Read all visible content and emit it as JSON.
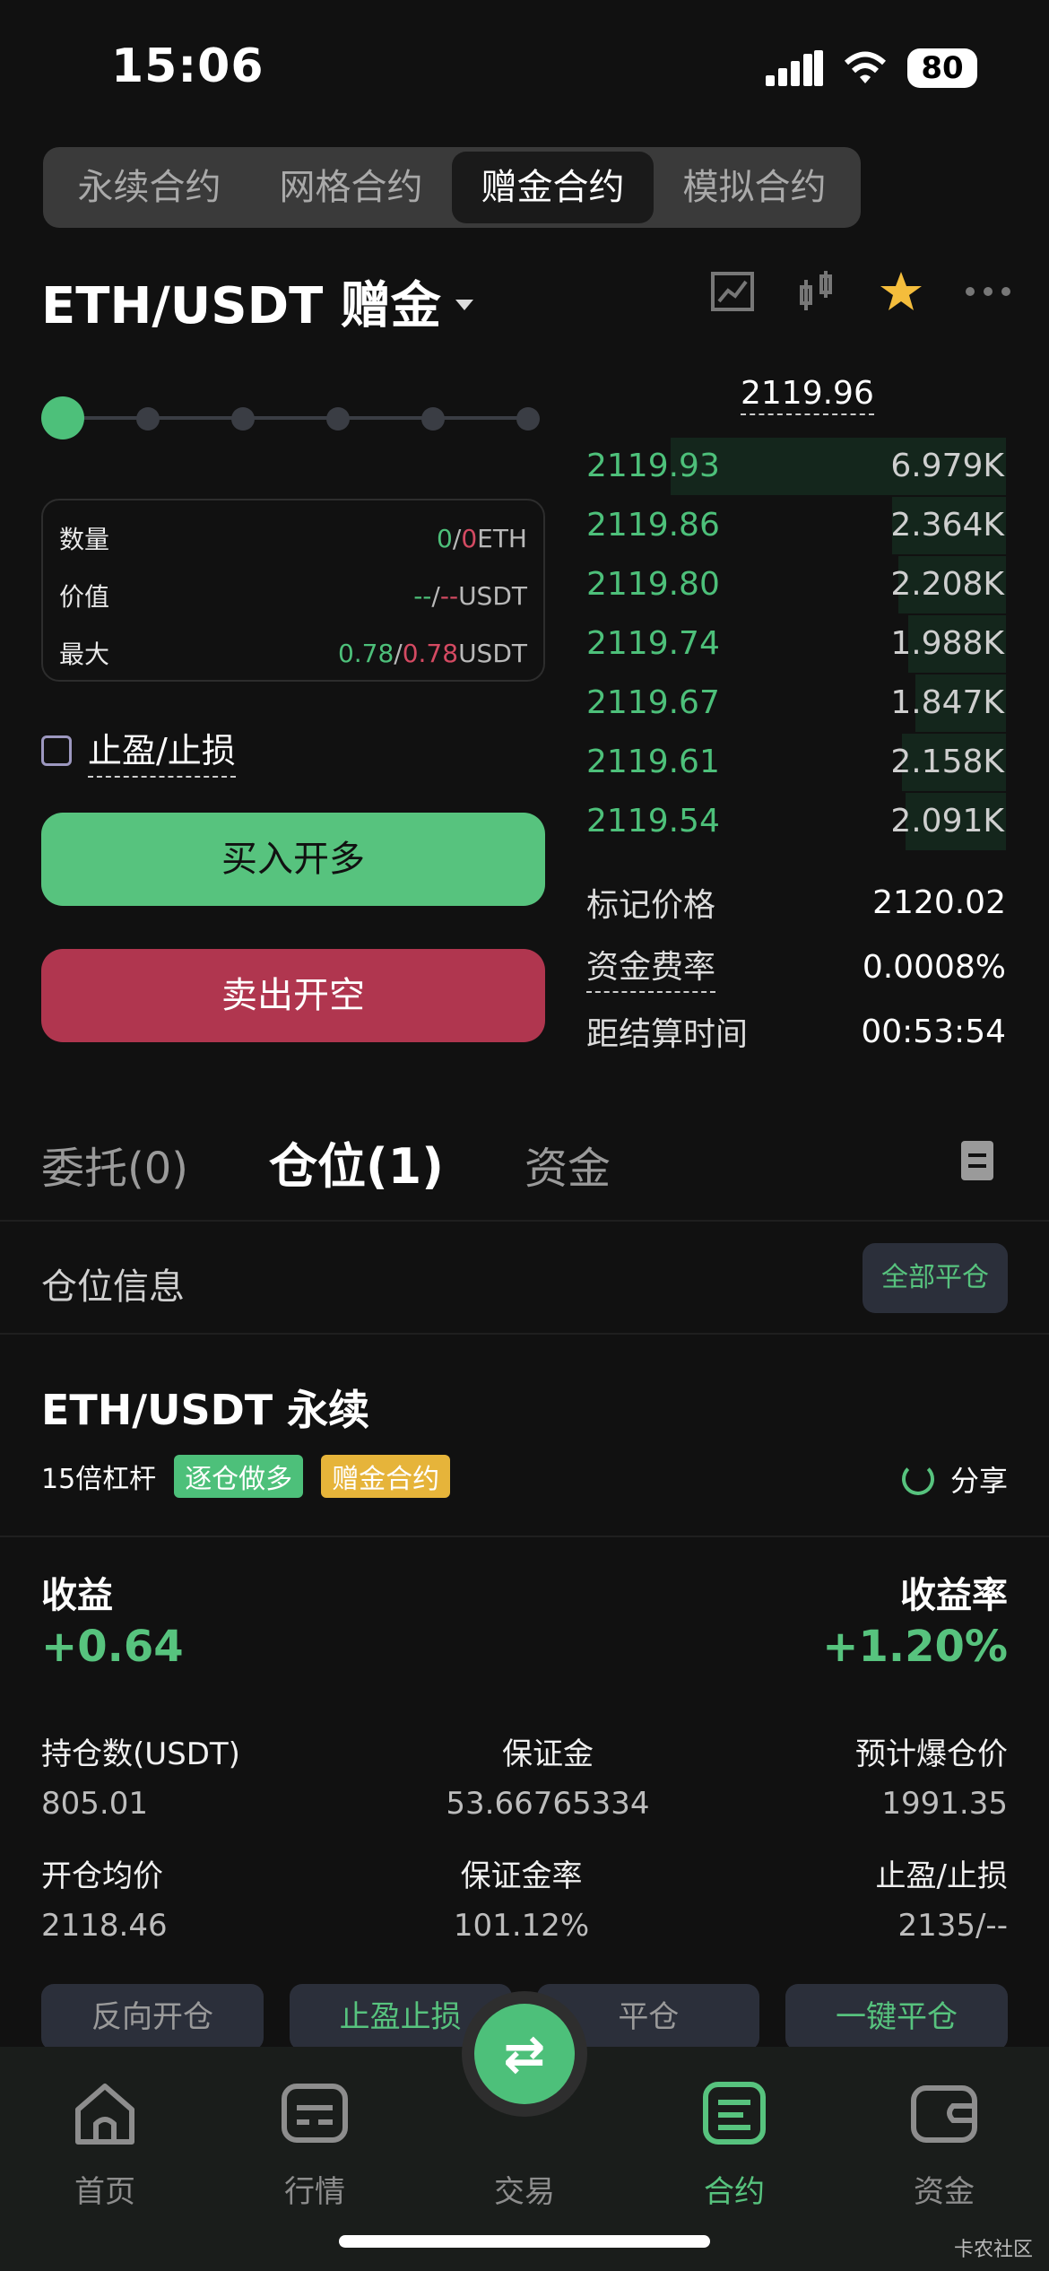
{
  "status_bar": {
    "time": "15:06",
    "battery": "80"
  },
  "segment_tabs": [
    {
      "label": "永续合约",
      "active": false
    },
    {
      "label": "网格合约",
      "active": false
    },
    {
      "label": "赠金合约",
      "active": true
    },
    {
      "label": "模拟合约",
      "active": false
    }
  ],
  "pair": {
    "title": "ETH/USDT 赠金"
  },
  "slider": {
    "value_fraction": 0
  },
  "order_info": {
    "quantity": {
      "label": "数量",
      "long": "0",
      "short": "0",
      "unit": "ETH"
    },
    "value": {
      "label": "价值",
      "long": "--",
      "short": "--",
      "unit": "USDT"
    },
    "max": {
      "label": "最大",
      "long": "0.78",
      "short": "0.78",
      "unit": "USDT"
    }
  },
  "tpsl_label": "止盈/止损",
  "buy_button": "买入开多",
  "sell_button": "卖出开空",
  "last_price": "2119.96",
  "orderbook": [
    {
      "price": "2119.93",
      "qty": "6.979K",
      "depth": 1.0
    },
    {
      "price": "2119.86",
      "qty": "2.364K",
      "depth": 0.34
    },
    {
      "price": "2119.80",
      "qty": "2.208K",
      "depth": 0.32
    },
    {
      "price": "2119.74",
      "qty": "1.988K",
      "depth": 0.29
    },
    {
      "price": "2119.67",
      "qty": "1.847K",
      "depth": 0.27
    },
    {
      "price": "2119.61",
      "qty": "2.158K",
      "depth": 0.31
    },
    {
      "price": "2119.54",
      "qty": "2.091K",
      "depth": 0.3
    }
  ],
  "stats": {
    "mark_price": {
      "label": "标记价格",
      "value": "2120.02"
    },
    "funding_rate": {
      "label": "资金费率",
      "value": "0.0008%"
    },
    "settlement": {
      "label": "距结算时间",
      "value": "00:53:54"
    }
  },
  "order_tabs": [
    {
      "label": "委托(0)",
      "active": false
    },
    {
      "label": "仓位(1)",
      "active": true
    },
    {
      "label": "资金",
      "active": false
    }
  ],
  "position_section": {
    "title": "仓位信息",
    "close_all": "全部平仓"
  },
  "position": {
    "symbol": "ETH/USDT 永续",
    "leverage": "15倍杠杆",
    "tag_mode": "逐仓做多",
    "tag_type": "赠金合约",
    "share": "分享",
    "pnl_label": "收益",
    "pnl_value": "+0.64",
    "roe_label": "收益率",
    "roe_value": "+1.20%",
    "size_label": "持仓数(USDT)",
    "size_value": "805.01",
    "margin_label": "保证金",
    "margin_value": "53.66765334",
    "liq_label": "预计爆仓价",
    "liq_value": "1991.35",
    "entry_label": "开仓均价",
    "entry_value": "2118.46",
    "margin_ratio_label": "保证金率",
    "margin_ratio_value": "101.12%",
    "tpsl_label": "止盈/止损",
    "tpsl_value": "2135/--",
    "actions": [
      "反向开仓",
      "止盈止损",
      "平仓",
      "一键平仓"
    ]
  },
  "bottom_nav": [
    {
      "label": "首页",
      "icon": "home-icon",
      "active": false
    },
    {
      "label": "行情",
      "icon": "market-icon",
      "active": false
    },
    {
      "label": "交易",
      "icon": "swap-icon",
      "active": false
    },
    {
      "label": "合约",
      "icon": "contract-icon",
      "active": true
    },
    {
      "label": "资金",
      "icon": "wallet-icon",
      "active": false
    }
  ],
  "watermark": "卡农社区",
  "colors": {
    "green": "#57c37e",
    "red": "#b0364f",
    "bg": "#111111",
    "yellow": "#e6b43a"
  }
}
